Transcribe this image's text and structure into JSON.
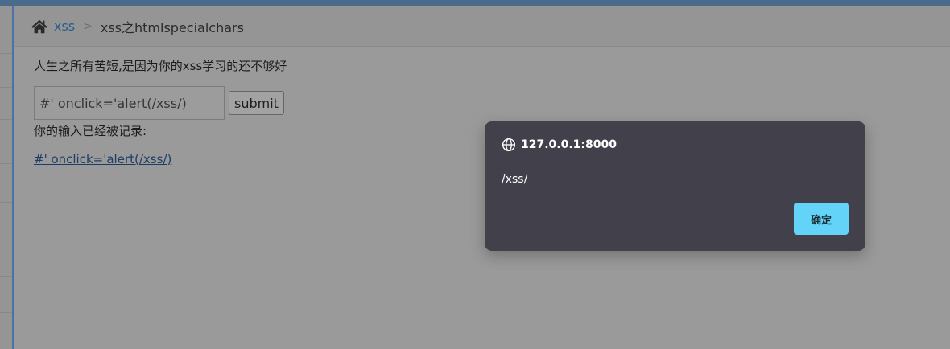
{
  "breadcrumb": {
    "home_icon": "home-icon",
    "link": "xss",
    "separator": ">",
    "current": "xss之htmlspecialchars"
  },
  "main": {
    "headline": "人生之所有苦短,是因为你的xss学习的还不够好",
    "input_value": "#' onclick='alert(/xss/)",
    "submit_label": "submit",
    "recorded_label": "你的输入已经被记录:",
    "result_link": "#' onclick='alert(/xss/)"
  },
  "dialog": {
    "origin_icon": "globe-icon",
    "origin": "127.0.0.1:8000",
    "message": "/xss/",
    "ok_label": "确定"
  },
  "colors": {
    "topbar": "#4a6b8c",
    "link": "#2c5a8f",
    "dialog_bg": "#42404b",
    "ok_button": "#63d3f7"
  }
}
